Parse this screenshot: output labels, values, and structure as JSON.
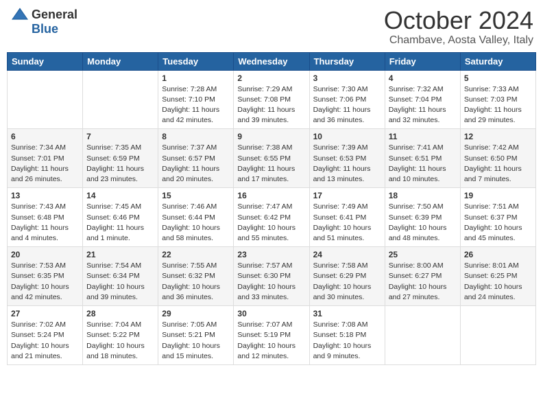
{
  "header": {
    "logo_general": "General",
    "logo_blue": "Blue",
    "month_title": "October 2024",
    "location": "Chambave, Aosta Valley, Italy"
  },
  "days_of_week": [
    "Sunday",
    "Monday",
    "Tuesday",
    "Wednesday",
    "Thursday",
    "Friday",
    "Saturday"
  ],
  "weeks": [
    [
      {
        "day": "",
        "info": ""
      },
      {
        "day": "",
        "info": ""
      },
      {
        "day": "1",
        "info": "Sunrise: 7:28 AM\nSunset: 7:10 PM\nDaylight: 11 hours and 42 minutes."
      },
      {
        "day": "2",
        "info": "Sunrise: 7:29 AM\nSunset: 7:08 PM\nDaylight: 11 hours and 39 minutes."
      },
      {
        "day": "3",
        "info": "Sunrise: 7:30 AM\nSunset: 7:06 PM\nDaylight: 11 hours and 36 minutes."
      },
      {
        "day": "4",
        "info": "Sunrise: 7:32 AM\nSunset: 7:04 PM\nDaylight: 11 hours and 32 minutes."
      },
      {
        "day": "5",
        "info": "Sunrise: 7:33 AM\nSunset: 7:03 PM\nDaylight: 11 hours and 29 minutes."
      }
    ],
    [
      {
        "day": "6",
        "info": "Sunrise: 7:34 AM\nSunset: 7:01 PM\nDaylight: 11 hours and 26 minutes."
      },
      {
        "day": "7",
        "info": "Sunrise: 7:35 AM\nSunset: 6:59 PM\nDaylight: 11 hours and 23 minutes."
      },
      {
        "day": "8",
        "info": "Sunrise: 7:37 AM\nSunset: 6:57 PM\nDaylight: 11 hours and 20 minutes."
      },
      {
        "day": "9",
        "info": "Sunrise: 7:38 AM\nSunset: 6:55 PM\nDaylight: 11 hours and 17 minutes."
      },
      {
        "day": "10",
        "info": "Sunrise: 7:39 AM\nSunset: 6:53 PM\nDaylight: 11 hours and 13 minutes."
      },
      {
        "day": "11",
        "info": "Sunrise: 7:41 AM\nSunset: 6:51 PM\nDaylight: 11 hours and 10 minutes."
      },
      {
        "day": "12",
        "info": "Sunrise: 7:42 AM\nSunset: 6:50 PM\nDaylight: 11 hours and 7 minutes."
      }
    ],
    [
      {
        "day": "13",
        "info": "Sunrise: 7:43 AM\nSunset: 6:48 PM\nDaylight: 11 hours and 4 minutes."
      },
      {
        "day": "14",
        "info": "Sunrise: 7:45 AM\nSunset: 6:46 PM\nDaylight: 11 hours and 1 minute."
      },
      {
        "day": "15",
        "info": "Sunrise: 7:46 AM\nSunset: 6:44 PM\nDaylight: 10 hours and 58 minutes."
      },
      {
        "day": "16",
        "info": "Sunrise: 7:47 AM\nSunset: 6:42 PM\nDaylight: 10 hours and 55 minutes."
      },
      {
        "day": "17",
        "info": "Sunrise: 7:49 AM\nSunset: 6:41 PM\nDaylight: 10 hours and 51 minutes."
      },
      {
        "day": "18",
        "info": "Sunrise: 7:50 AM\nSunset: 6:39 PM\nDaylight: 10 hours and 48 minutes."
      },
      {
        "day": "19",
        "info": "Sunrise: 7:51 AM\nSunset: 6:37 PM\nDaylight: 10 hours and 45 minutes."
      }
    ],
    [
      {
        "day": "20",
        "info": "Sunrise: 7:53 AM\nSunset: 6:35 PM\nDaylight: 10 hours and 42 minutes."
      },
      {
        "day": "21",
        "info": "Sunrise: 7:54 AM\nSunset: 6:34 PM\nDaylight: 10 hours and 39 minutes."
      },
      {
        "day": "22",
        "info": "Sunrise: 7:55 AM\nSunset: 6:32 PM\nDaylight: 10 hours and 36 minutes."
      },
      {
        "day": "23",
        "info": "Sunrise: 7:57 AM\nSunset: 6:30 PM\nDaylight: 10 hours and 33 minutes."
      },
      {
        "day": "24",
        "info": "Sunrise: 7:58 AM\nSunset: 6:29 PM\nDaylight: 10 hours and 30 minutes."
      },
      {
        "day": "25",
        "info": "Sunrise: 8:00 AM\nSunset: 6:27 PM\nDaylight: 10 hours and 27 minutes."
      },
      {
        "day": "26",
        "info": "Sunrise: 8:01 AM\nSunset: 6:25 PM\nDaylight: 10 hours and 24 minutes."
      }
    ],
    [
      {
        "day": "27",
        "info": "Sunrise: 7:02 AM\nSunset: 5:24 PM\nDaylight: 10 hours and 21 minutes."
      },
      {
        "day": "28",
        "info": "Sunrise: 7:04 AM\nSunset: 5:22 PM\nDaylight: 10 hours and 18 minutes."
      },
      {
        "day": "29",
        "info": "Sunrise: 7:05 AM\nSunset: 5:21 PM\nDaylight: 10 hours and 15 minutes."
      },
      {
        "day": "30",
        "info": "Sunrise: 7:07 AM\nSunset: 5:19 PM\nDaylight: 10 hours and 12 minutes."
      },
      {
        "day": "31",
        "info": "Sunrise: 7:08 AM\nSunset: 5:18 PM\nDaylight: 10 hours and 9 minutes."
      },
      {
        "day": "",
        "info": ""
      },
      {
        "day": "",
        "info": ""
      }
    ]
  ]
}
